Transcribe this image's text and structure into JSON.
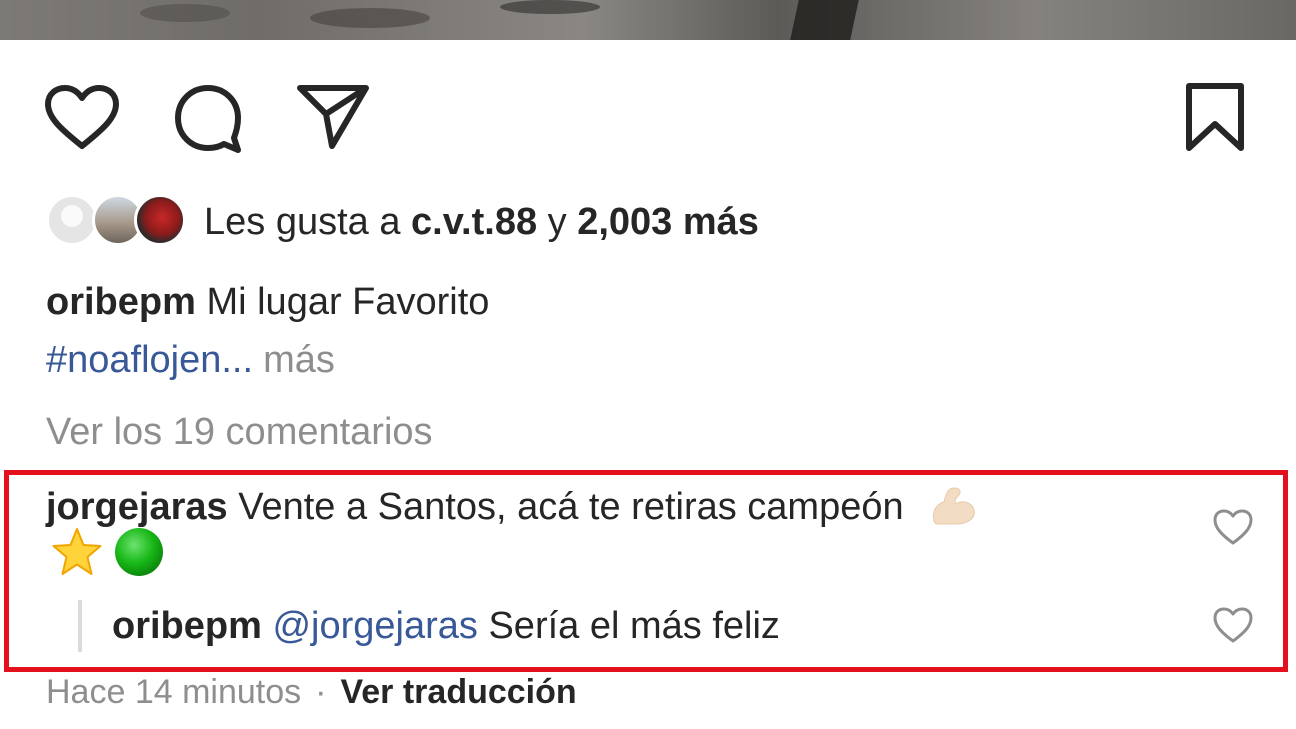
{
  "post": {
    "actions": {
      "like_icon": "heart-icon",
      "comment_icon": "comment-icon",
      "share_icon": "send-icon",
      "save_icon": "bookmark-icon"
    },
    "likes": {
      "prefix": "Les gusta a ",
      "user": "c.v.t.88",
      "connector": " y ",
      "count": "2,003 más"
    },
    "caption": {
      "username": "oribepm",
      "text": " Mi lugar Favorito",
      "hashtag": "#noaflojen...",
      "more": "más"
    },
    "view_comments": "Ver los 19 comentarios",
    "comment": {
      "username": "jorgejaras",
      "text": " Vente a Santos, acá te retiras campeón",
      "emojis": [
        "flexed-biceps-emoji",
        "star-emoji",
        "green-circle-emoji"
      ]
    },
    "reply": {
      "username": "oribepm",
      "mention": "@jorgejaras",
      "text": " Sería el más feliz"
    },
    "meta": {
      "time": "Hace 14 minutos",
      "separator": "·",
      "translate": "Ver traducción"
    },
    "colors": {
      "highlight_border": "#e3101e",
      "link": "#385898",
      "muted": "#8e8e8e",
      "text": "#262626"
    }
  }
}
